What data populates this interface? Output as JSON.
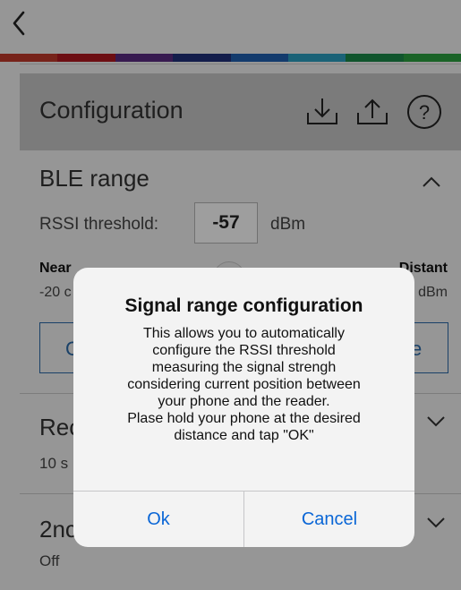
{
  "colors": {
    "stripe": [
      "#c0392b",
      "#b01820",
      "#5a2a82",
      "#1f2f7a",
      "#1f5fb0",
      "#2a9fc0",
      "#1a8a4a",
      "#2aa040"
    ],
    "accent": "#2a6aa8",
    "dialog_button": "#0a66d6"
  },
  "nav": {
    "back_icon": "chevron-left-icon"
  },
  "header": {
    "title": "Configuration",
    "icons": [
      "download-icon",
      "upload-icon",
      "help-icon"
    ]
  },
  "ble_range": {
    "title": "BLE range",
    "rssi_label": "RSSI threshold:",
    "rssi_value": "-57",
    "rssi_unit": "dBm",
    "near_label": "Near",
    "near_value_partial": "-20 c",
    "distant_label": "Distant",
    "distant_value_partial": "dBm",
    "btn_left_partial": "C",
    "btn_right_partial": "e"
  },
  "rows": [
    {
      "title_partial": "Rec",
      "sub_partial": "10 s"
    },
    {
      "title_partial": "2nc",
      "sub": "Off"
    }
  ],
  "dialog": {
    "title": "Signal range configuration",
    "message_lines": [
      "This allows you to automatically",
      "configure the RSSI threshold",
      "measuring the signal strengh",
      "considering current position between",
      "your phone and the reader.",
      "Plase hold your phone at the desired",
      "distance and tap \"OK\""
    ],
    "ok": "Ok",
    "cancel": "Cancel"
  }
}
